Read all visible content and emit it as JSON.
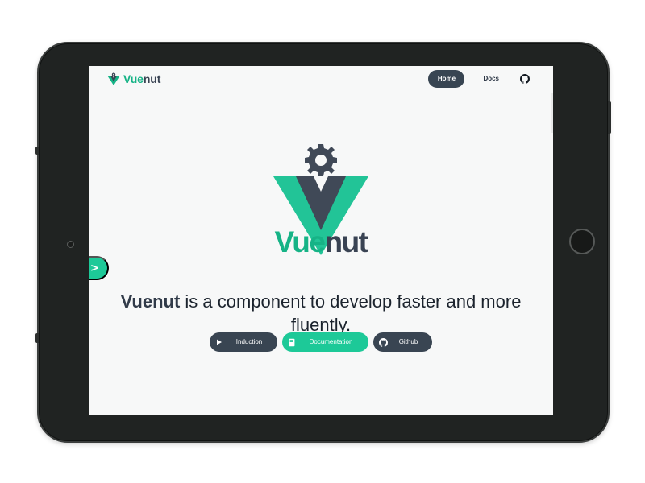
{
  "brand": {
    "name_prefix": "Vue",
    "name_suffix": "nut",
    "logo_icon": "vuenut-logo-icon"
  },
  "nav": {
    "items": [
      {
        "label": "Home",
        "active": true
      },
      {
        "label": "Docs",
        "active": false
      }
    ],
    "github_icon": "github-icon"
  },
  "hero": {
    "wordmark_prefix": "Vue",
    "wordmark_suffix": "nut",
    "tagline_strong": "Vuenut",
    "tagline_rest": " is a component to develop faster and more fluently.",
    "actions": [
      {
        "label": "Induction",
        "icon": "play-icon",
        "style": "dark"
      },
      {
        "label": "Documentation",
        "icon": "book-icon",
        "style": "primary"
      },
      {
        "label": "Github",
        "icon": "github-icon",
        "style": "dark"
      }
    ]
  },
  "sidebar_toggle": {
    "label": ">",
    "icon": "chevron-right-icon"
  },
  "colors": {
    "accent": "#1dc998",
    "accent_dark": "#16b386",
    "dark": "#394552",
    "background": "#f7f8f8",
    "device": "#202322"
  }
}
